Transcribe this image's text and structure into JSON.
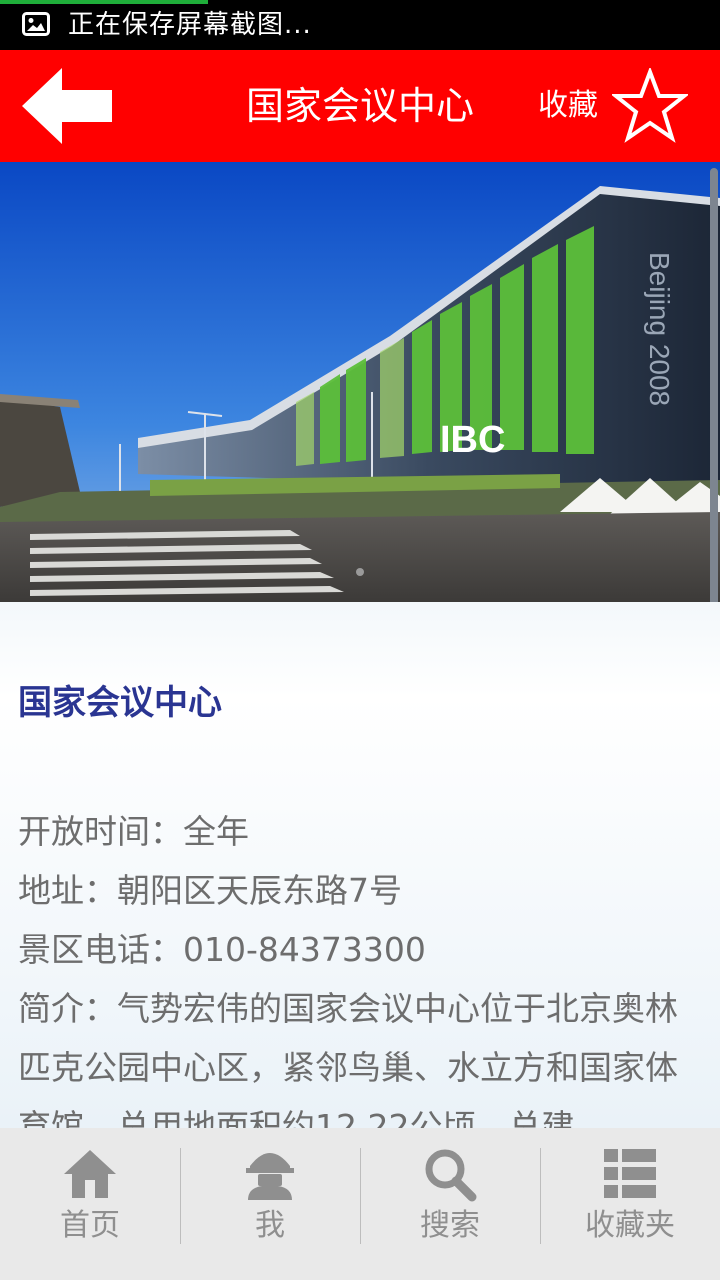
{
  "status_bar": {
    "notification_text": "正在保存屏幕截图..."
  },
  "header": {
    "title": "国家会议中心",
    "favorite_label": "收藏",
    "background_color": "#ff0000"
  },
  "detail": {
    "title": "国家会议中心",
    "open_hours": "开放时间：全年",
    "address": "地址：朝阳区天辰东路7号",
    "phone": "景区电话：010-84373300",
    "intro": "简介：气势宏伟的国家会议中心位于北京奥林匹克公园中心区，紧邻鸟巢、水立方和国家体育馆，总用地面积约12.22公顷，总建"
  },
  "tabs": [
    {
      "label": "首页",
      "icon": "home-icon"
    },
    {
      "label": "我",
      "icon": "user-icon"
    },
    {
      "label": "搜索",
      "icon": "search-icon"
    },
    {
      "label": "收藏夹",
      "icon": "list-icon"
    }
  ]
}
